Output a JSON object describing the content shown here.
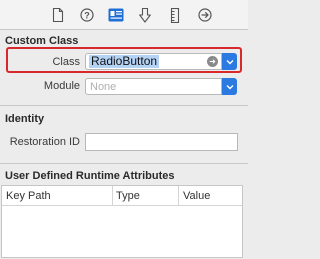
{
  "toolbar": {
    "icons": [
      "file-icon",
      "help-icon",
      "identity-inspector-icon",
      "attributes-inspector-icon",
      "size-inspector-icon",
      "connections-inspector-icon"
    ],
    "active": "identity-inspector-icon"
  },
  "custom_class": {
    "title": "Custom Class",
    "class_label": "Class",
    "class_value": "RadioButton",
    "module_label": "Module",
    "module_placeholder": "None"
  },
  "identity": {
    "title": "Identity",
    "restoration_label": "Restoration ID",
    "restoration_value": ""
  },
  "runtime_attributes": {
    "title": "User Defined Runtime Attributes",
    "columns": [
      "Key Path",
      "Type",
      "Value"
    ],
    "rows": []
  },
  "colors": {
    "highlight": "#d8282b",
    "accent": "#2a7ae2",
    "selection": "#b4d2f4"
  }
}
